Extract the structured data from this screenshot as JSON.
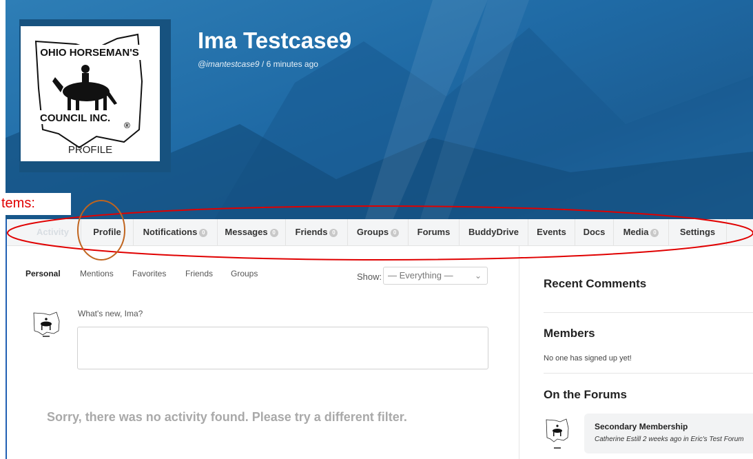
{
  "annotation": {
    "label": "tems:"
  },
  "profile": {
    "name": "Ima Testcase9",
    "handle": "@imantestcase9",
    "last_active": " / 6 minutes ago",
    "avatar_logo_lines": [
      "OHIO HORSEMAN'S",
      "COUNCIL INC.",
      "®",
      "PROFILE"
    ]
  },
  "nav": {
    "items": [
      {
        "label": "Activity",
        "badge": ""
      },
      {
        "label": "Profile",
        "badge": ""
      },
      {
        "label": "Notifications",
        "badge": "0"
      },
      {
        "label": "Messages",
        "badge": "0"
      },
      {
        "label": "Friends",
        "badge": "0"
      },
      {
        "label": "Groups",
        "badge": "0"
      },
      {
        "label": "Forums",
        "badge": ""
      },
      {
        "label": "BuddyDrive",
        "badge": ""
      },
      {
        "label": "Events",
        "badge": ""
      },
      {
        "label": "Docs",
        "badge": ""
      },
      {
        "label": "Media",
        "badge": "0"
      },
      {
        "label": "Settings",
        "badge": ""
      }
    ]
  },
  "activity": {
    "subnav": [
      "Personal",
      "Mentions",
      "Favorites",
      "Friends",
      "Groups"
    ],
    "show_label": "Show:",
    "filter_value": "— Everything —",
    "whats_new": "What's new, Ima?",
    "empty_message": "Sorry, there was no activity found. Please try a different filter."
  },
  "sidebar": {
    "recent_comments": "Recent Comments",
    "members": "Members",
    "members_empty": "No one has signed up yet!",
    "forums_title": "On the Forums",
    "forum_post": {
      "title": "Secondary Membership",
      "meta": "Catherine Estill 2 weeks ago in Eric's Test Forum"
    }
  },
  "colors": {
    "hero": "#1f6aa5",
    "annotation_red": "#e00000",
    "annotation_orange": "#c0641e"
  }
}
